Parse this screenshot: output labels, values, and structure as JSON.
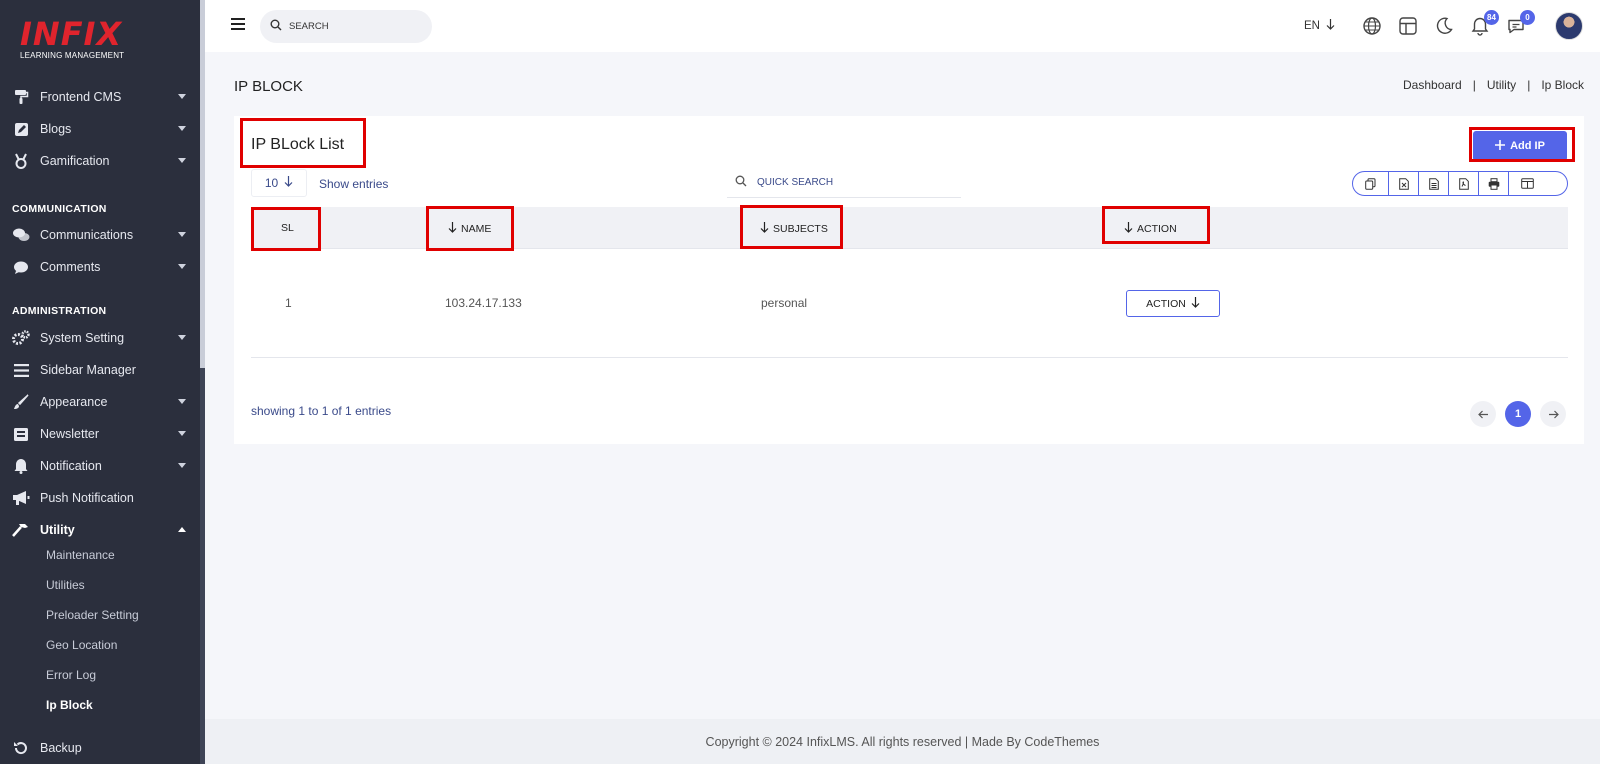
{
  "logo": {
    "main": "INFIX",
    "sub": "LEARNING MANAGEMENT"
  },
  "sidebar": {
    "items_top": [
      {
        "label": "Frontend CMS",
        "icon": "paint-roller-icon"
      },
      {
        "label": "Blogs",
        "icon": "edit-icon"
      },
      {
        "label": "Gamification",
        "icon": "medal-icon"
      }
    ],
    "section_communication": "COMMUNICATION",
    "items_comm": [
      {
        "label": "Communications",
        "icon": "chat-bubbles-icon"
      },
      {
        "label": "Comments",
        "icon": "comment-icon"
      }
    ],
    "section_administration": "ADMINISTRATION",
    "items_admin": [
      {
        "label": "System Setting",
        "icon": "gears-icon"
      },
      {
        "label": "Sidebar Manager",
        "icon": "bars-icon"
      },
      {
        "label": "Appearance",
        "icon": "brush-icon"
      },
      {
        "label": "Newsletter",
        "icon": "envelope-open-icon"
      },
      {
        "label": "Notification",
        "icon": "bell-icon"
      },
      {
        "label": "Push Notification",
        "icon": "megaphone-icon"
      },
      {
        "label": "Utility",
        "icon": "hammer-icon"
      }
    ],
    "utility_sub": [
      "Maintenance",
      "Utilities",
      "Preloader Setting",
      "Geo Location",
      "Error Log",
      "Ip Block"
    ],
    "backup": {
      "label": "Backup",
      "icon": "undo-icon"
    }
  },
  "topbar": {
    "search_placeholder": "SEARCH",
    "lang": "EN",
    "notification_count": "84",
    "message_count": "0"
  },
  "page": {
    "title": "IP BLOCK",
    "breadcrumb": [
      "Dashboard",
      "Utility",
      "Ip Block"
    ],
    "separator": "|"
  },
  "card": {
    "title": "IP BLock List",
    "add_button": "Add IP",
    "entries_value": "10",
    "entries_label": "Show entries",
    "quick_search_placeholder": "QUICK SEARCH"
  },
  "table": {
    "headers": [
      "SL",
      "NAME",
      "SUBJECTS",
      "ACTION"
    ],
    "rows": [
      {
        "sl": "1",
        "name": "103.24.17.133",
        "subjects": "personal",
        "action": "ACTION"
      }
    ]
  },
  "pagination": {
    "showing": "showing 1 to 1 of 1 entries",
    "current_page": "1"
  },
  "footer": {
    "text": "Copyright © 2024 InfixLMS. All rights reserved | Made By CodeThemes"
  },
  "colors": {
    "accent": "#5465e8",
    "sidebar": "#2b2f3d",
    "logo_red": "#e0242d",
    "highlight": "#e00000"
  }
}
